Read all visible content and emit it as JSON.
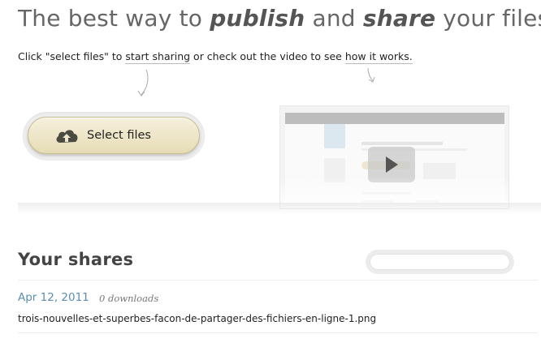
{
  "headline": {
    "part1": "The best way to ",
    "publish": "publish",
    "part2": " and ",
    "share": "share",
    "part3": " your files"
  },
  "intro": {
    "text1": "Click \"select files\" to ",
    "link1": "start sharing",
    "text2": " or check out the video to see ",
    "link2": "how it works."
  },
  "upload": {
    "button_label": "Select files",
    "icon": "cloud-upload-icon"
  },
  "video": {
    "icon": "play-icon"
  },
  "shares": {
    "title": "Your shares",
    "search_value": "",
    "items": [
      {
        "date": "Apr 12, 2011",
        "downloads": "0 downloads",
        "filename": "trois-nouvelles-et-superbes-facon-de-partager-des-fichiers-en-ligne-1.png"
      }
    ]
  },
  "colors": {
    "date_link": "#5b8eb0",
    "button_top": "#f5f0dc",
    "button_bottom": "#e6dcb5"
  }
}
